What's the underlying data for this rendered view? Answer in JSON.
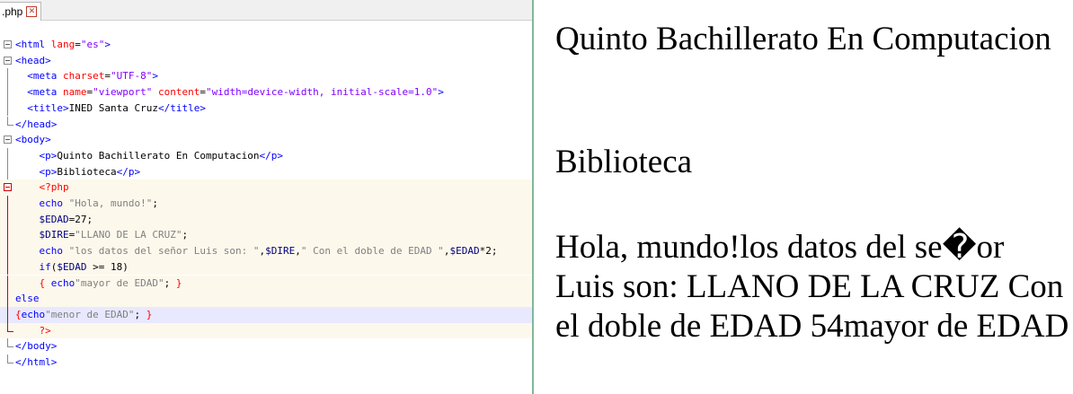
{
  "editor": {
    "tab_label": ".php",
    "tab_close_icon": "close-icon",
    "lines": [
      {
        "t": "<html lang=\"es\">"
      },
      {
        "t": "<head>"
      },
      {
        "t": "  <meta charset=\"UTF-8\">"
      },
      {
        "t": "  <meta name=\"viewport\" content=\"width=device-width, initial-scale=1.0\">"
      },
      {
        "t": "  <title>INED Santa Cruz</title>"
      },
      {
        "t": "</head>"
      },
      {
        "t": "<body>"
      },
      {
        "t": "    <p>Quinto Bachillerato En Computacion</p>"
      },
      {
        "t": "    <p>Biblioteca</p>"
      },
      {
        "t": "    <?php"
      },
      {
        "t": "    echo \"Hola, mundo!\";"
      },
      {
        "t": "    $EDAD=27;"
      },
      {
        "t": "    $DIRE=\"LLANO DE LA CRUZ\";"
      },
      {
        "t": "    echo \"los datos del señor Luis son: \",$DIRE,\" Con el doble de EDAD \",$EDAD*2;"
      },
      {
        "t": "    if($EDAD >= 18)"
      },
      {
        "t": "    { echo\"mayor de EDAD\"; }"
      },
      {
        "t": "else"
      },
      {
        "t": "{echo\"menor de EDAD\"; }"
      },
      {
        "t": "    ?>"
      },
      {
        "t": "</body>"
      },
      {
        "t": "</html>"
      }
    ]
  },
  "output": {
    "p1": "Quinto Bachillerato En Computacion",
    "p2": "Biblioteca",
    "p3": "Hola, mundo!los datos del se�or Luis son: LLANO DE LA CRUZ Con el doble de EDAD 54mayor de EDAD"
  },
  "colors": {
    "tag": "#0000ff",
    "attribute": "#ff0000",
    "attribute_value": "#8000ff",
    "php_delimiter": "#ff0000",
    "php_string": "#808080",
    "php_block_bg": "#fdf8ec",
    "current_line_bg": "#e8e8ff",
    "pane_divider": "#7fb89a"
  }
}
